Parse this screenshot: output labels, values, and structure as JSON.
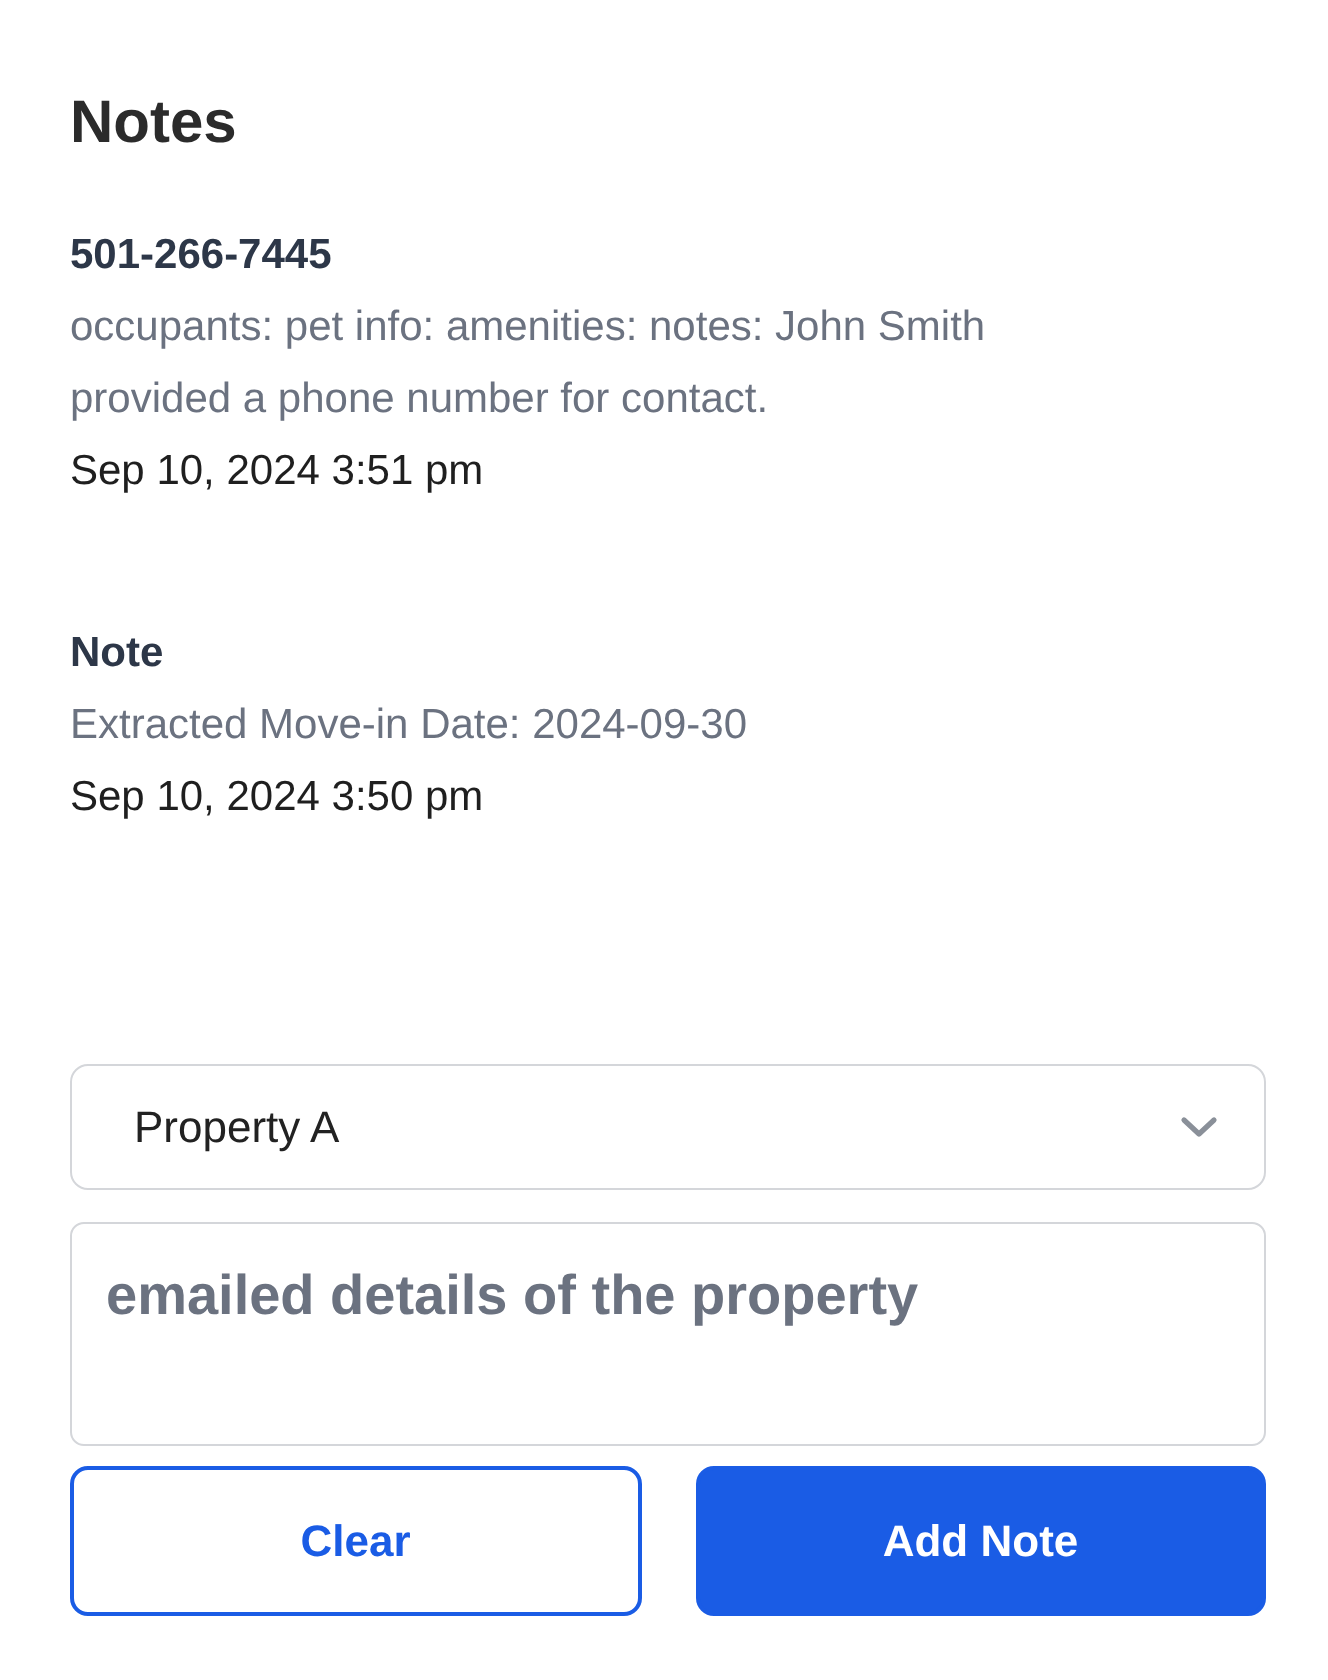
{
  "title": "Notes",
  "notes": [
    {
      "heading": "501-266-7445",
      "body": "occupants: pet info: amenities: notes: John Smith provided a phone number for contact.",
      "timestamp": "Sep 10, 2024 3:51 pm"
    },
    {
      "heading": "Note",
      "body": "Extracted Move-in Date: 2024-09-30",
      "timestamp": "Sep 10, 2024 3:50 pm"
    }
  ],
  "form": {
    "property_select": {
      "value": "Property A"
    },
    "note_field": {
      "placeholder": "emailed details of the property"
    },
    "buttons": [
      {
        "label": "Clear",
        "kind": "outline"
      },
      {
        "label": "Add Note",
        "kind": "primary"
      }
    ]
  }
}
